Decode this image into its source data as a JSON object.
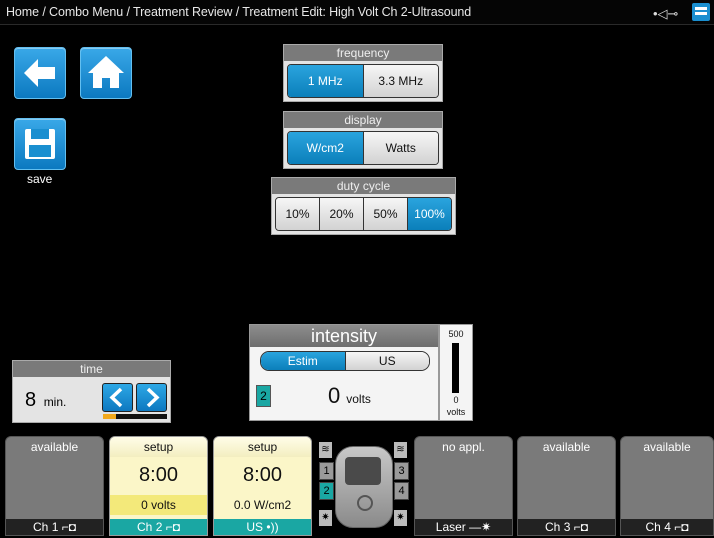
{
  "topbar": {
    "breadcrumb": "Home / Combo Menu / Treatment Review / Treatment Edit: High Volt Ch 2-Ultrasound",
    "usb_icon": "usb-icon",
    "drive_icon": "drive-icon"
  },
  "nav": {
    "back_icon": "arrow-left-icon",
    "home_icon": "home-icon",
    "save_icon": "floppy-icon",
    "save_label": "save"
  },
  "frequency": {
    "title": "frequency",
    "options": [
      "1 MHz",
      "3.3 MHz"
    ],
    "selected": "1 MHz"
  },
  "display": {
    "title": "display",
    "options": [
      "W/cm2",
      "Watts"
    ],
    "selected": "W/cm2"
  },
  "duty_cycle": {
    "title": "duty cycle",
    "options": [
      "10%",
      "20%",
      "50%",
      "100%"
    ],
    "selected": "100%"
  },
  "time": {
    "title": "time",
    "value": "8",
    "unit": "min.",
    "progress": 0.2
  },
  "intensity": {
    "title": "intensity",
    "modes": [
      "Estim",
      "US"
    ],
    "selected_mode": "Estim",
    "channel": "2",
    "value": "0",
    "unit": "volts"
  },
  "meter": {
    "max": "500",
    "min": "0",
    "unit": "volts",
    "level": 0
  },
  "channels": [
    {
      "head": "available",
      "foot": "Ch 1",
      "icon": "electrode-icon"
    },
    {
      "head": "setup",
      "time": "8:00",
      "value": "0 volts",
      "foot": "Ch 2",
      "icon": "electrode-icon"
    },
    {
      "head": "setup",
      "time": "8:00",
      "value": "0.0 W/cm2",
      "foot": "US",
      "icon": "ultrasound-icon"
    },
    {
      "head": "no appl.",
      "foot": "Laser",
      "icon": "laser-icon"
    },
    {
      "head": "available",
      "foot": "Ch 3",
      "icon": "electrode-icon"
    },
    {
      "head": "available",
      "foot": "Ch 4",
      "icon": "electrode-icon"
    }
  ],
  "device": {
    "left_leds": [
      "1",
      "2"
    ],
    "right_leds": [
      "3",
      "4"
    ],
    "icon": "device-icon"
  },
  "colors": {
    "accent": "#0c7fc0",
    "teal": "#1aa7a3",
    "setup": "#fbf6c8",
    "progress": "#f1a81c"
  }
}
